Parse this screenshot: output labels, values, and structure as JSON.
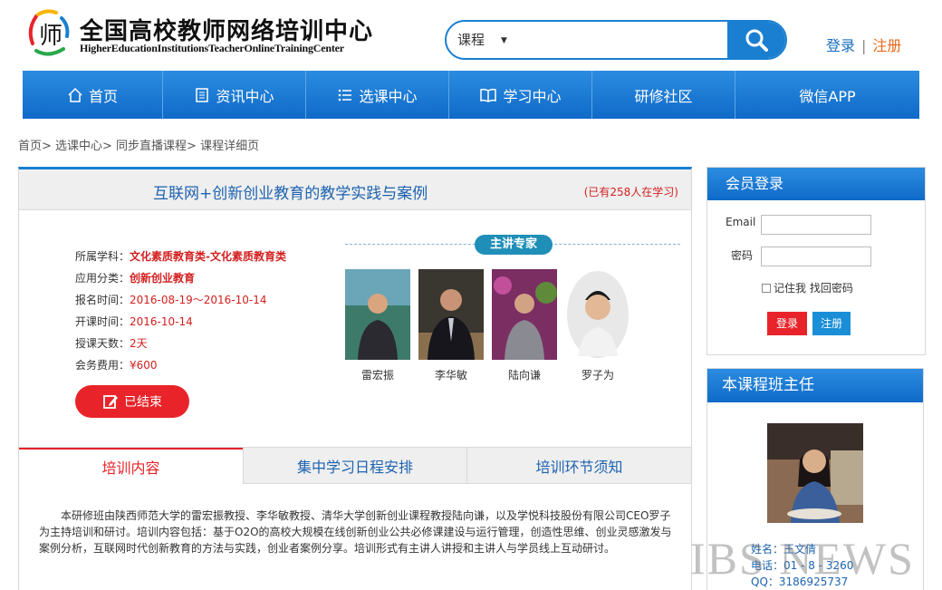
{
  "header": {
    "logo_cn": "全国高校教师网络培训中心",
    "logo_en": "HigherEducationInstitutionsTeacherOnlineTrainingCenter",
    "search": {
      "category": "课程",
      "placeholder": ""
    },
    "auth": {
      "login": "登录",
      "separator": "|",
      "register": "注册"
    }
  },
  "nav": {
    "items": [
      {
        "label": "首页",
        "icon": "home-icon"
      },
      {
        "label": "资讯中心",
        "icon": "news-icon"
      },
      {
        "label": "选课中心",
        "icon": "list-icon"
      },
      {
        "label": "学习中心",
        "icon": "book-icon"
      },
      {
        "label": "研修社区",
        "icon": ""
      },
      {
        "label": "微信APP",
        "icon": ""
      }
    ]
  },
  "breadcrumb": "首页> 选课中心> 同步直播课程> 课程详细页",
  "course": {
    "title": "互联网+创新创业教育的教学实践与案例",
    "learners": "(已有258人在学习)",
    "info": [
      {
        "label": "所属学科：",
        "value": "文化素质教育类-文化素质教育类"
      },
      {
        "label": "应用分类：",
        "value": "创新创业教育"
      },
      {
        "label": "报名时间：",
        "value": "2016-08-19～2016-10-14"
      },
      {
        "label": "开课时间：",
        "value": "2016-10-14"
      },
      {
        "label": "授课天数：",
        "value": "2天"
      },
      {
        "label": "会务费用：",
        "value": "¥600"
      }
    ],
    "status_button": "已结束",
    "experts_title": "主讲专家",
    "experts": [
      {
        "name": "雷宏振"
      },
      {
        "name": "李华敏"
      },
      {
        "name": "陆向谦"
      },
      {
        "name": "罗子为"
      }
    ],
    "tabs": [
      {
        "label": "培训内容"
      },
      {
        "label": "集中学习日程安排"
      },
      {
        "label": "培训环节须知"
      }
    ],
    "description": "本研修班由陕西师范大学的雷宏振教授、李华敏教授、清华大学创新创业课程教授陆向谦，以及学悦科技股份有限公司CEO罗子为主持培训和研讨。培训内容包括：基于O2O的高校大规模在线创新创业公共必修课建设与运行管理，创造性思维、创业灵感激发与案例分析，互联网时代创新教育的方法与实践，创业者案例分享。培训形式有主讲人讲授和主讲人与学员线上互动研讨。"
  },
  "sidebar": {
    "login": {
      "title": "会员登录",
      "email_label": "Email",
      "password_label": "密码",
      "remember": "记住我",
      "forgot": "找回密码",
      "login_button": "登录",
      "register_button": "注册"
    },
    "teacher": {
      "title": "本课程班主任",
      "name_line": "姓名：王文倩",
      "phone_line": "电话：01 - 8 - 3260",
      "qq_line": "QQ：3186925737"
    }
  },
  "watermark": "IBS NEWS",
  "colors": {
    "brand_blue": "#1a7fd1",
    "accent_red": "#e8242a",
    "link_orange": "#e86a1a"
  }
}
